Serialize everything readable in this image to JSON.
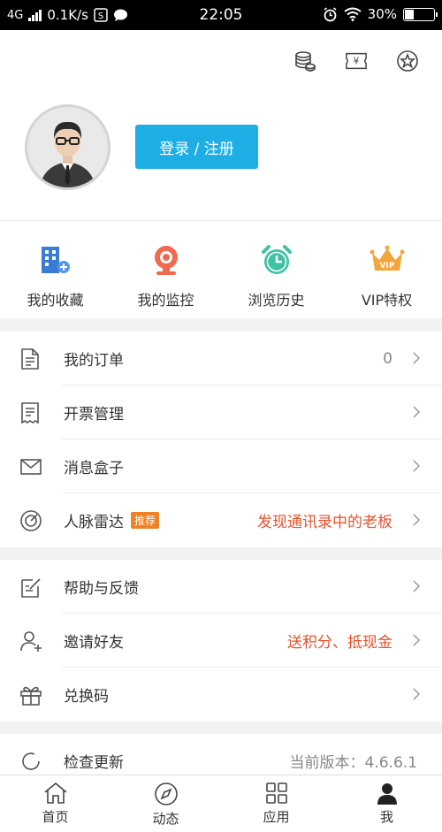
{
  "status_bar": {
    "network": "4G",
    "speed": "0.1K/s",
    "time": "22:05",
    "battery": "30%"
  },
  "header": {
    "login_label": "登录 / 注册",
    "top_icons": [
      "coins-icon",
      "ticket-icon",
      "star-icon"
    ]
  },
  "quick_actions": [
    {
      "label": "我的收藏",
      "icon": "building-plus-icon",
      "color": "#3a7bd5"
    },
    {
      "label": "我的监控",
      "icon": "webcam-icon",
      "color": "#f06a4f"
    },
    {
      "label": "浏览历史",
      "icon": "alarm-clock-icon",
      "color": "#3fc1a5"
    },
    {
      "label": "VIP特权",
      "icon": "crown-icon",
      "color": "#f4a53c"
    }
  ],
  "group1": [
    {
      "label": "我的订单",
      "value": "0",
      "icon": "document-icon"
    },
    {
      "label": "开票管理",
      "value": "",
      "icon": "receipt-icon"
    },
    {
      "label": "消息盒子",
      "value": "",
      "icon": "mail-icon"
    },
    {
      "label": "人脉雷达",
      "badge": "推荐",
      "value": "发现通讯录中的老板",
      "icon": "radar-icon"
    }
  ],
  "group2": [
    {
      "label": "帮助与反馈",
      "value": "",
      "icon": "edit-icon"
    },
    {
      "label": "邀请好友",
      "value": "送积分、抵现金",
      "icon": "add-user-icon"
    },
    {
      "label": "兑换码",
      "value": "",
      "icon": "gift-icon"
    }
  ],
  "group3": [
    {
      "label": "检查更新",
      "value": "当前版本：4.6.6.1",
      "icon": "refresh-icon"
    }
  ],
  "bottom_nav": [
    {
      "label": "首页",
      "icon": "home-icon"
    },
    {
      "label": "动态",
      "icon": "compass-icon"
    },
    {
      "label": "应用",
      "icon": "grid-icon"
    },
    {
      "label": "我",
      "icon": "user-icon"
    }
  ],
  "colors": {
    "accent": "#1eaee6",
    "highlight": "#e8512a",
    "badge": "#f08125"
  }
}
